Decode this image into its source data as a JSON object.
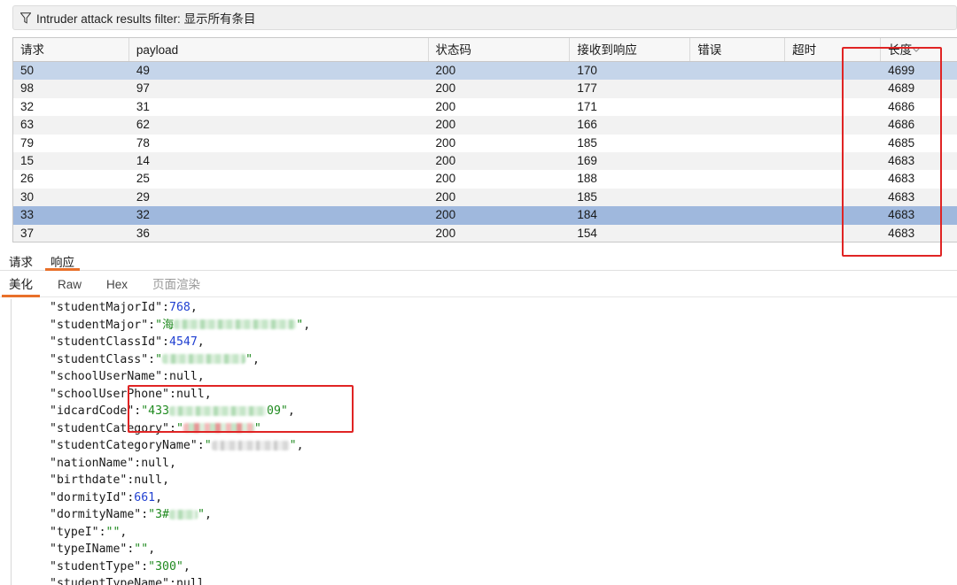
{
  "filter": {
    "label": "Intruder attack results filter: 显示所有条目"
  },
  "table": {
    "columns": [
      "请求",
      "payload",
      "状态码",
      "接收到响应",
      "错误",
      "超时",
      "长度"
    ],
    "rows": [
      [
        "50",
        "49",
        "200",
        "170",
        "",
        "",
        "4699"
      ],
      [
        "98",
        "97",
        "200",
        "177",
        "",
        "",
        "4689"
      ],
      [
        "32",
        "31",
        "200",
        "171",
        "",
        "",
        "4686"
      ],
      [
        "63",
        "62",
        "200",
        "166",
        "",
        "",
        "4686"
      ],
      [
        "79",
        "78",
        "200",
        "185",
        "",
        "",
        "4685"
      ],
      [
        "15",
        "14",
        "200",
        "169",
        "",
        "",
        "4683"
      ],
      [
        "26",
        "25",
        "200",
        "188",
        "",
        "",
        "4683"
      ],
      [
        "30",
        "29",
        "200",
        "185",
        "",
        "",
        "4683"
      ],
      [
        "33",
        "32",
        "200",
        "184",
        "",
        "",
        "4683"
      ],
      [
        "37",
        "36",
        "200",
        "154",
        "",
        "",
        "4683"
      ]
    ]
  },
  "tabs": {
    "request": "请求",
    "response": "响应"
  },
  "sub_tabs": {
    "pretty": "美化",
    "raw": "Raw",
    "hex": "Hex",
    "render": "页面渲染"
  },
  "code": {
    "l01_key": "\"studentMajorId\"",
    "l01_val": "768",
    "l02_key": "\"studentMajor\"",
    "l02_pre": "\"海",
    "l02_post": "\"",
    "l03_key": "\"studentClassId\"",
    "l03_val": "4547",
    "l04_key": "\"studentClass\"",
    "l04_pre": "\"",
    "l04_post": "\"",
    "l05_key": "\"schoolUserName\"",
    "l05_val": "null",
    "l06_key": "\"schoolUserPhone\"",
    "l06_val": "null",
    "l07_key": "\"idcardCode\"",
    "l07_pre": "\"433",
    "l07_post": "09\"",
    "l08_key": "\"studentCategory\"",
    "l08_pre": "\"",
    "l08_post": "\"",
    "l09_key": "\"studentCategoryName\"",
    "l09_pre": "\"",
    "l09_post": "\"",
    "l10_key": "\"nationName\"",
    "l10_val": "null",
    "l11_key": "\"birthdate\"",
    "l11_val": "null",
    "l12_key": "\"dormityId\"",
    "l12_val": "661",
    "l13_key": "\"dormityName\"",
    "l13_pre": "\"3#",
    "l13_post": "\"",
    "l14_key": "\"typeI\"",
    "l14_val": "\"\"",
    "l15_key": "\"typeIName\"",
    "l15_val": "\"\"",
    "l16_key": "\"studentType\"",
    "l16_val": "\"300\"",
    "l17_key": "\"studentTypeName\"",
    "l17_val": "null",
    "sep": ":",
    "comma": ","
  }
}
